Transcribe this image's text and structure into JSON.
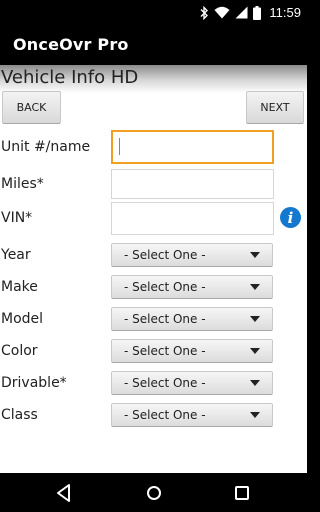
{
  "status_bar": {
    "time": "11:59",
    "icons": [
      "bluetooth-icon",
      "wifi-icon",
      "signal-icon",
      "battery-icon"
    ]
  },
  "app_bar": {
    "title": "OnceOvr Pro"
  },
  "page": {
    "title": "Vehicle Info HD",
    "back_label": "BACK",
    "next_label": "NEXT"
  },
  "fields": {
    "unit": {
      "label": "Unit #/name",
      "value": ""
    },
    "miles": {
      "label": "Miles*",
      "value": ""
    },
    "vin": {
      "label": "VIN*",
      "value": "",
      "info_icon": "info-icon"
    }
  },
  "selects": [
    {
      "label": "Year",
      "value": "- Select One -"
    },
    {
      "label": "Make",
      "value": "- Select One -"
    },
    {
      "label": "Model",
      "value": "- Select One -"
    },
    {
      "label": "Color",
      "value": "- Select One -"
    },
    {
      "label": "Drivable*",
      "value": "- Select One -"
    },
    {
      "label": "Class",
      "value": "- Select One -"
    }
  ],
  "nav_bar": {
    "icons": [
      "back-icon",
      "home-icon",
      "recents-icon"
    ]
  },
  "colors": {
    "focus_border": "#f0a020",
    "info": "#1478cf"
  }
}
